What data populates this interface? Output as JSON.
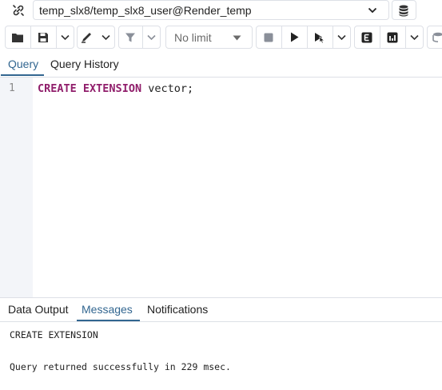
{
  "connection": {
    "label": "temp_slx8/temp_slx8_user@Render_temp",
    "icon": "link-icon",
    "db_icon": "database-stack-icon"
  },
  "toolbar": {
    "icons": [
      "folder-open-icon",
      "save-icon",
      "chevron-down-icon",
      "pen-icon",
      "chevron-down-icon",
      "filter-icon",
      "chevron-down-icon",
      "stop-icon",
      "play-icon",
      "play-cursor-icon",
      "chevron-down-icon",
      "explain-icon",
      "explain-analyze-icon",
      "chevron-down-icon"
    ],
    "limit_label": "No limit"
  },
  "tabs": [
    {
      "label": "Query",
      "active": true
    },
    {
      "label": "Query History",
      "active": false
    }
  ],
  "editor": {
    "line_number": "1",
    "keyword1": "CREATE",
    "keyword2": "EXTENSION",
    "rest": " vector;"
  },
  "output_tabs": [
    {
      "label": "Data Output",
      "active": false
    },
    {
      "label": "Messages",
      "active": true
    },
    {
      "label": "Notifications",
      "active": false
    }
  ],
  "messages": {
    "line1": "CREATE EXTENSION",
    "line2": "Query returned successfully in 229 msec."
  },
  "colors": {
    "accent": "#326690",
    "keyword": "#901e6b",
    "gutter": "#f3f5f9",
    "border": "#dde0e6"
  }
}
